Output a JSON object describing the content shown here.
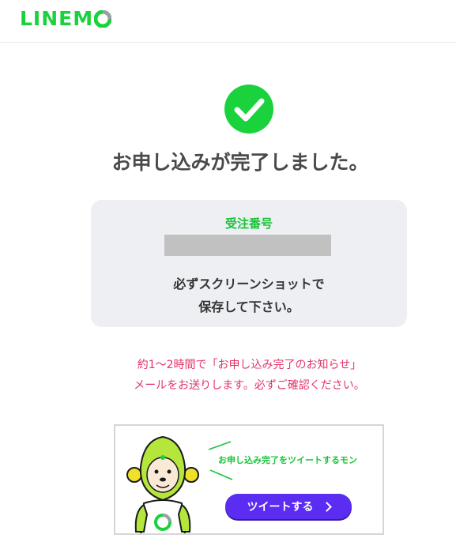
{
  "header": {
    "logo_text": "LINEM",
    "logo_color": "#19d23c"
  },
  "status": {
    "icon": "check-circle-icon",
    "title": "お申し込みが完了しました。",
    "icon_color": "#19d23c"
  },
  "order": {
    "label": "受注番号",
    "number_redacted": true,
    "note_line1": "必ずスクリーンショットで",
    "note_line2": "保存して下さい。"
  },
  "mail_notice": {
    "line1": "約1〜2時間で「お申し込み完了のお知らせ」",
    "line2": "メールをお送りします。必ずご確認ください。",
    "color": "#e23568"
  },
  "tweet_banner": {
    "caption": "お申し込み完了をツイートするモン",
    "button_label": "ツイートする",
    "button_color": "#5b2cf2"
  }
}
